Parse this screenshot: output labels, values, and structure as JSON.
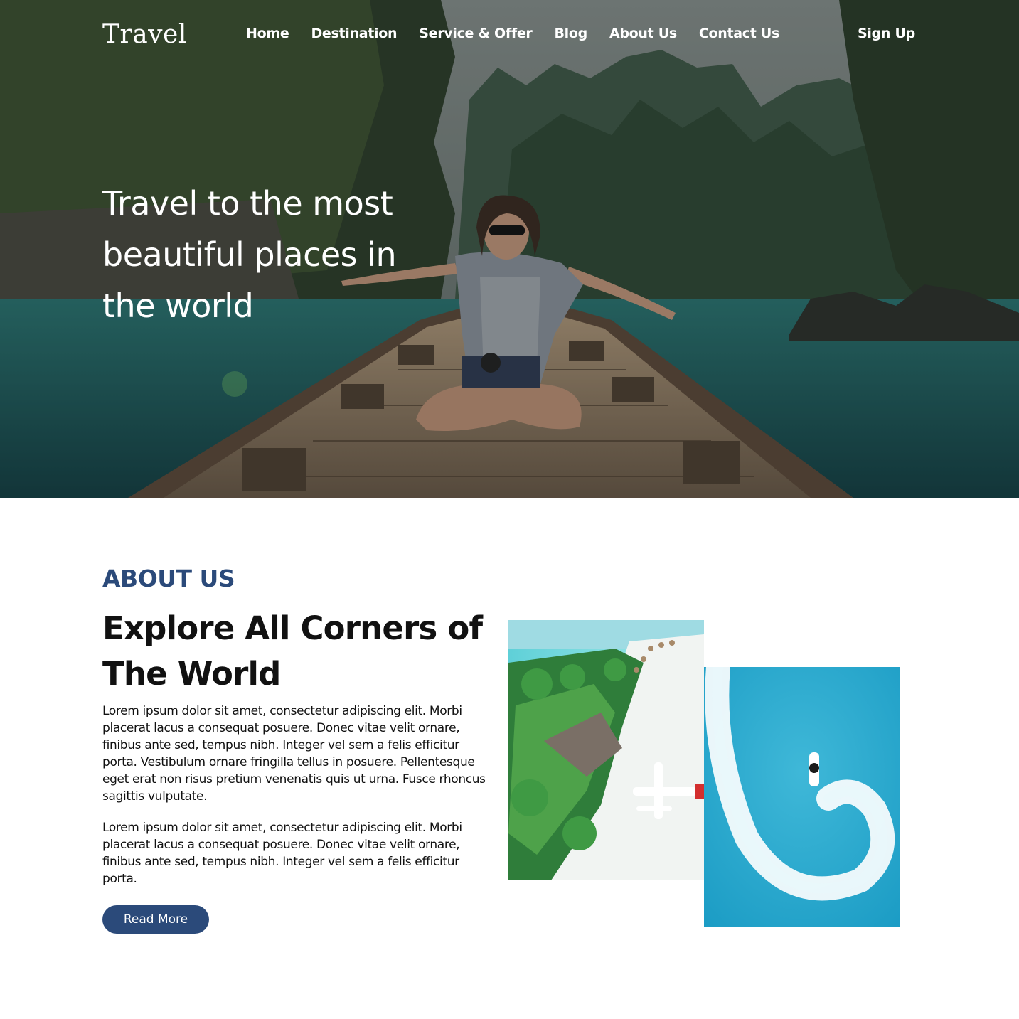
{
  "brand": {
    "logo": "Travel"
  },
  "nav": {
    "items": [
      {
        "label": "Home"
      },
      {
        "label": "Destination"
      },
      {
        "label": "Service & Offer"
      },
      {
        "label": "Blog"
      },
      {
        "label": "About Us"
      },
      {
        "label": "Contact Us"
      }
    ],
    "signup_label": "Sign Up"
  },
  "hero": {
    "headline": "Travel to the most beautiful places in the world"
  },
  "about": {
    "eyebrow": "ABOUT US",
    "title": "Explore All Corners of The World",
    "paragraph_1": "Lorem ipsum dolor sit amet, consectetur adipiscing elit. Morbi placerat lacus a consequat posuere. Donec vitae velit ornare, finibus ante sed, tempus nibh. Integer vel sem a felis efficitur porta. Vestibulum ornare fringilla tellus in posuere. Pellentesque eget erat non risus pretium venenatis quis ut urna. Fusce rhoncus sagittis vulputate.",
    "paragraph_2": "Lorem ipsum dolor sit amet, consectetur adipiscing elit. Morbi placerat lacus a consequat posuere. Donec vitae velit ornare, finibus ante sed, tempus nibh. Integer vel sem a felis efficitur porta.",
    "read_more_label": "Read More"
  },
  "colors": {
    "accent": "#2b4a7a",
    "text": "#111111",
    "hero_text": "#ffffff"
  }
}
